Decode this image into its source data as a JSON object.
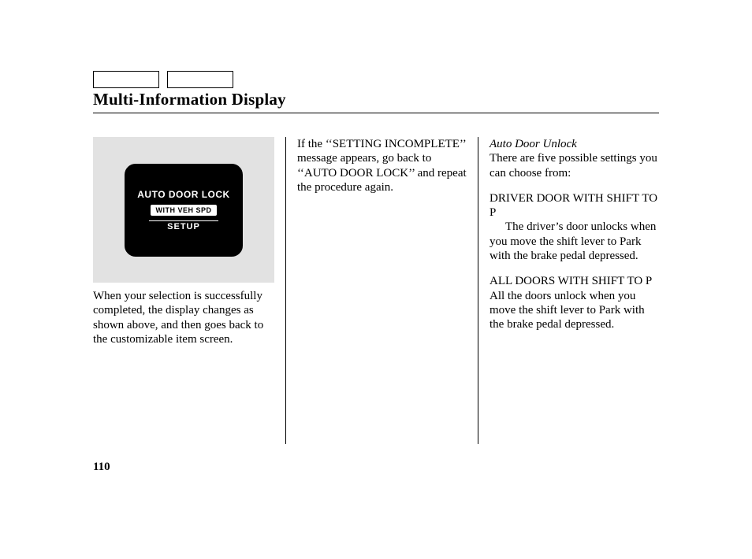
{
  "header": {
    "title": "Multi-Information Display"
  },
  "display": {
    "line1": "AUTO DOOR LOCK",
    "chip": "WITH VEH SPD",
    "setup": "SETUP"
  },
  "col1": {
    "p1": "When your selection is successfully completed, the display changes as shown above, and then goes back to the customizable item screen."
  },
  "col2": {
    "p1": "If the ‘‘SETTING INCOMPLETE’’ message appears, go back to ‘‘AUTO DOOR LOCK’’ and repeat the procedure again."
  },
  "col3": {
    "heading": "Auto Door Unlock",
    "p1": "There are five possible settings you can choose from:",
    "h1": "DRIVER DOOR WITH SHIFT TO P",
    "h1d1": "The driver’s door unlocks when",
    "h1d2": "you move the shift lever to Park with the brake pedal depressed.",
    "h2": "ALL DOORS WITH SHIFT TO P",
    "h2d": "All the doors unlock when you move the shift lever to Park with the brake pedal depressed."
  },
  "page_number": "110"
}
